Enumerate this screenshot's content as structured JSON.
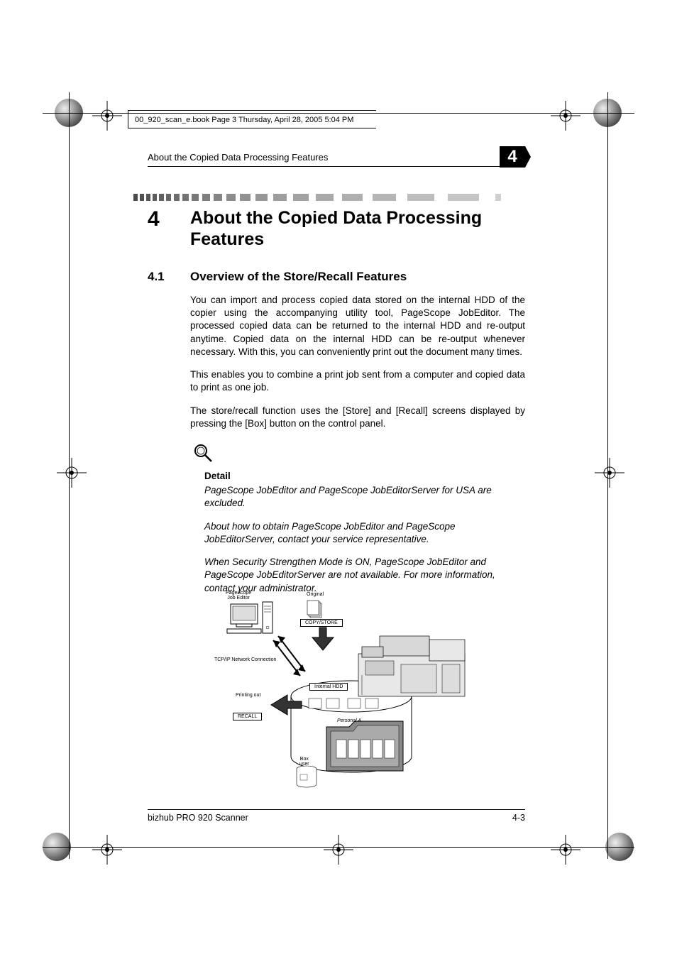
{
  "bookInfoLine": "00_920_scan_e.book  Page 3  Thursday, April 28, 2005  5:04 PM",
  "runningHeader": "About the Copied Data Processing Features",
  "chapterBadge": "4",
  "chapter": {
    "number": "4",
    "title": "About the Copied Data Processing Features"
  },
  "section": {
    "number": "4.1",
    "title": "Overview of the Store/Recall Features"
  },
  "paragraphs": [
    "You can import and process copied data stored on the internal HDD of the copier using the accompanying utility tool, PageScope JobEditor. The processed copied data can be returned to the internal HDD and re-output anytime. Copied data on the internal HDD can be re-output whenever necessary. With this, you can conveniently print out the document many times.",
    "This enables you to combine a print job sent from a computer and copied data to print as one job.",
    "The store/recall function uses the [Store] and [Recall] screens displayed by pressing the [Box] button on the control panel."
  ],
  "detail": {
    "heading": "Detail",
    "items": [
      "PageScope JobEditor and PageScope JobEditorServer for USA are excluded.",
      "About how to obtain PageScope JobEditor and PageScope JobEditorServer, contact your service representative.",
      "When Security Strengthen Mode is ON, PageScope JobEditor and PageScope JobEditorServer are not available. For more information, contact your administrator."
    ]
  },
  "diagram": {
    "pagescope": "PageScope\nJob Editor",
    "original": "Original",
    "copystore": "COPY/STORE",
    "tcpip": "TCP/IP Network Connection",
    "internalhdd": "Internal HDD",
    "printing": "Printing out",
    "recall": "RECALL",
    "personal": "Personal A",
    "boxuser": "Box\nuser"
  },
  "footer": {
    "product": "bizhub PRO 920 Scanner",
    "page": "4-3"
  }
}
